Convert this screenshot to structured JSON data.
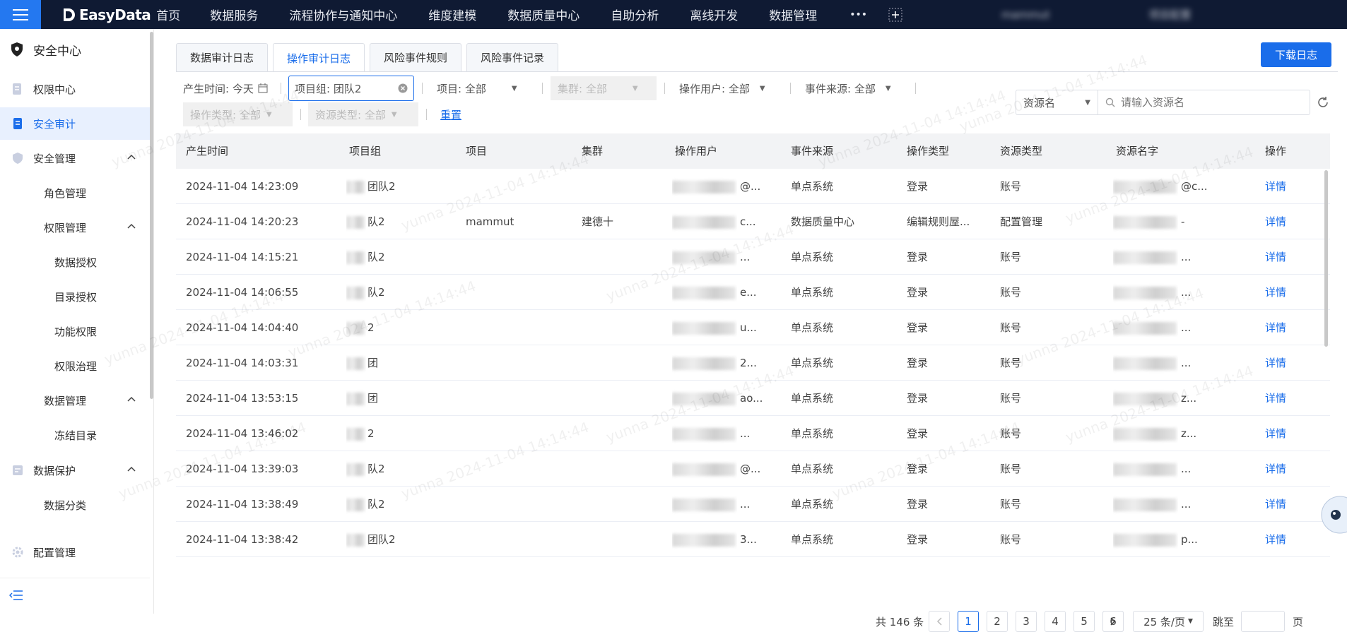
{
  "app": {
    "logo": "EasyData"
  },
  "nav": {
    "items": [
      "首页",
      "数据服务",
      "流程协作与通知中心",
      "维度建模",
      "数据质量中心",
      "自助分析",
      "离线开发",
      "数据管理"
    ],
    "more": "•••",
    "user": "mammut",
    "project_config": "项目配置"
  },
  "sidebar": {
    "title": "安全中心",
    "items": [
      {
        "label": "权限中心"
      },
      {
        "label": "安全审计"
      },
      {
        "label": "安全管理"
      },
      {
        "label": "角色管理"
      },
      {
        "label": "权限管理"
      },
      {
        "label": "数据授权"
      },
      {
        "label": "目录授权"
      },
      {
        "label": "功能权限"
      },
      {
        "label": "权限治理"
      },
      {
        "label": "数据管理"
      },
      {
        "label": "冻结目录"
      },
      {
        "label": "数据保护"
      },
      {
        "label": "数据分类"
      },
      {
        "label": "配置管理"
      }
    ]
  },
  "tabs": [
    "数据审计日志",
    "操作审计日志",
    "风险事件规则",
    "风险事件记录"
  ],
  "download_btn": "下载日志",
  "filters": {
    "time_label": "产生时间: 今天",
    "group_value": "项目组: 团队2",
    "project": "项目: 全部",
    "cluster": "集群: 全部",
    "operator": "操作用户: 全部",
    "source": "事件来源: 全部",
    "op_type": "操作类型: 全部",
    "res_type": "资源类型: 全部",
    "reset": "重置",
    "res_name_select": "资源名",
    "search_placeholder": "请输入资源名"
  },
  "table": {
    "headers": [
      "产生时间",
      "项目组",
      "项目",
      "集群",
      "操作用户",
      "事件来源",
      "操作类型",
      "资源类型",
      "资源名字",
      "操作"
    ],
    "rows": [
      {
        "time": "2024-11-04 14:23:09",
        "group": "团队2",
        "project": "",
        "cluster": "",
        "user": "@...",
        "source": "单点系统",
        "type": "登录",
        "res_type": "账号",
        "res_name": "@c...",
        "op": "详情"
      },
      {
        "time": "2024-11-04 14:20:23",
        "group": "队2",
        "project": "mammut",
        "cluster": "建德十",
        "user": "c...",
        "source": "数据质量中心",
        "type": "编辑规则屋...",
        "res_type": "配置管理",
        "res_name": "-",
        "op": "详情"
      },
      {
        "time": "2024-11-04 14:15:21",
        "group": "队2",
        "project": "",
        "cluster": "",
        "user": "...",
        "source": "单点系统",
        "type": "登录",
        "res_type": "账号",
        "res_name": "...",
        "op": "详情"
      },
      {
        "time": "2024-11-04 14:06:55",
        "group": "队2",
        "project": "",
        "cluster": "",
        "user": "e...",
        "source": "单点系统",
        "type": "登录",
        "res_type": "账号",
        "res_name": "...",
        "op": "详情"
      },
      {
        "time": "2024-11-04 14:04:40",
        "group": "2",
        "project": "",
        "cluster": "",
        "user": "u...",
        "source": "单点系统",
        "type": "登录",
        "res_type": "账号",
        "res_name": "...",
        "op": "详情"
      },
      {
        "time": "2024-11-04 14:03:31",
        "group": "团",
        "project": "",
        "cluster": "",
        "user": "2...",
        "source": "单点系统",
        "type": "登录",
        "res_type": "账号",
        "res_name": "...",
        "op": "详情"
      },
      {
        "time": "2024-11-04 13:53:15",
        "group": "团",
        "project": "",
        "cluster": "",
        "user": "ao...",
        "source": "单点系统",
        "type": "登录",
        "res_type": "账号",
        "res_name": "z...",
        "op": "详情"
      },
      {
        "time": "2024-11-04 13:46:02",
        "group": "2",
        "project": "",
        "cluster": "",
        "user": "...",
        "source": "单点系统",
        "type": "登录",
        "res_type": "账号",
        "res_name": "z...",
        "op": "详情"
      },
      {
        "time": "2024-11-04 13:39:03",
        "group": "队2",
        "project": "",
        "cluster": "",
        "user": "@...",
        "source": "单点系统",
        "type": "登录",
        "res_type": "账号",
        "res_name": "...",
        "op": "详情"
      },
      {
        "time": "2024-11-04 13:38:49",
        "group": "队2",
        "project": "",
        "cluster": "",
        "user": "...",
        "source": "单点系统",
        "type": "登录",
        "res_type": "账号",
        "res_name": "...",
        "op": "详情"
      },
      {
        "time": "2024-11-04 13:38:42",
        "group": "团队2",
        "project": "",
        "cluster": "",
        "user": "3...",
        "source": "单点系统",
        "type": "登录",
        "res_type": "账号",
        "res_name": "p...",
        "op": "详情"
      }
    ]
  },
  "pagination": {
    "total": "共 146 条",
    "pages": [
      "1",
      "2",
      "3",
      "4",
      "5",
      "6"
    ],
    "current": "1",
    "page_size": "25 条/页",
    "goto_label": "跳至",
    "page_unit": "页"
  },
  "watermark": "yunna 2024-11-04 14:14:44",
  "colors": {
    "accent": "#1a6dea",
    "topbar": "#0f1a33"
  }
}
